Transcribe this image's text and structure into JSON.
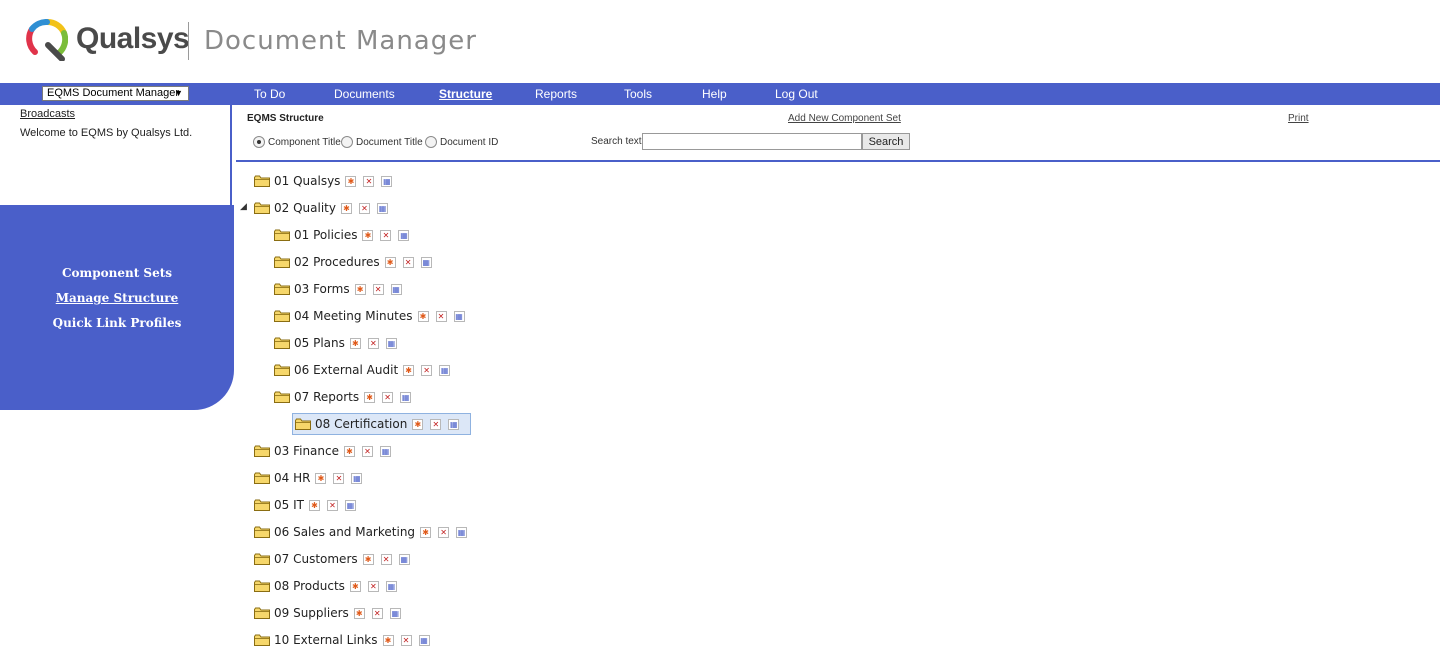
{
  "brand": {
    "name": "Qualsys",
    "app_title": "Document Manager",
    "colors": {
      "nav": "#4a5fc9",
      "logo_yellow": "#f2c218",
      "logo_green": "#7bbd3a",
      "logo_red": "#e0334a",
      "logo_blue": "#2f8fd3"
    }
  },
  "nav": {
    "app_select": "EQMS Document Manager",
    "items": [
      {
        "label": "To Do"
      },
      {
        "label": "Documents"
      },
      {
        "label": "Structure",
        "active": true
      },
      {
        "label": "Reports"
      },
      {
        "label": "Tools"
      },
      {
        "label": "Help"
      },
      {
        "label": "Log Out"
      }
    ]
  },
  "left": {
    "broadcasts": "Broadcasts",
    "welcome": "Welcome to EQMS by Qualsys Ltd.",
    "links": [
      {
        "label": "Component Sets"
      },
      {
        "label": "Manage Structure",
        "active": true
      },
      {
        "label": "Quick Link Profiles"
      }
    ]
  },
  "main": {
    "title": "EQMS Structure",
    "add_link": "Add New Component Set",
    "print_link": "Print",
    "radios": [
      {
        "label": "Component Title",
        "checked": true
      },
      {
        "label": "Document Title",
        "checked": false
      },
      {
        "label": "Document ID",
        "checked": false
      }
    ],
    "search_label": "Search text",
    "search_value": "",
    "search_button": "Search"
  },
  "tree": [
    {
      "label": "01 Qualsys",
      "level": 0
    },
    {
      "label": "02 Quality",
      "level": 0,
      "expanded": true
    },
    {
      "label": "01 Policies",
      "level": 1
    },
    {
      "label": "02 Procedures",
      "level": 1
    },
    {
      "label": "03 Forms",
      "level": 1
    },
    {
      "label": "04 Meeting Minutes",
      "level": 1
    },
    {
      "label": "05 Plans",
      "level": 1
    },
    {
      "label": "06 External Audit",
      "level": 1
    },
    {
      "label": "07 Reports",
      "level": 1
    },
    {
      "label": "08 Certification",
      "level": 1,
      "selected": true
    },
    {
      "label": "03 Finance",
      "level": 0
    },
    {
      "label": "04 HR",
      "level": 0
    },
    {
      "label": "05 IT",
      "level": 0
    },
    {
      "label": "06 Sales and Marketing",
      "level": 0
    },
    {
      "label": "07 Customers",
      "level": 0
    },
    {
      "label": "08 Products",
      "level": 0
    },
    {
      "label": "09 Suppliers",
      "level": 0
    },
    {
      "label": "10 External Links",
      "level": 0
    }
  ]
}
